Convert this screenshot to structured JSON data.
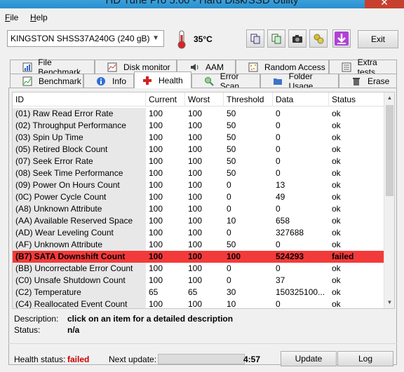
{
  "window": {
    "title": "HD Tune Pro 5.60 - Hard Disk/SSD Utility"
  },
  "menu": [
    {
      "label": "File",
      "accel": "F",
      "rest": "ile"
    },
    {
      "label": "Help",
      "accel": "H",
      "rest": "elp"
    }
  ],
  "toolbar": {
    "drive": "KINGSTON SHSS37A240G (240 gB)",
    "temperature": "35°C",
    "exit_label": "Exit"
  },
  "tabs_top": [
    "File Benchmark",
    "Disk monitor",
    "AAM",
    "Random Access",
    "Extra tests"
  ],
  "tabs_bottom": [
    "Benchmark",
    "Info",
    "Health",
    "Error Scan",
    "Folder Usage",
    "Erase"
  ],
  "active_tab": "Health",
  "table": {
    "columns": [
      "ID",
      "Current",
      "Worst",
      "Threshold",
      "Data",
      "Status"
    ],
    "rows": [
      [
        "(01) Raw Read Error Rate",
        "100",
        "100",
        "50",
        "0",
        "ok"
      ],
      [
        "(02) Throughput Performance",
        "100",
        "100",
        "50",
        "0",
        "ok"
      ],
      [
        "(03) Spin Up Time",
        "100",
        "100",
        "50",
        "0",
        "ok"
      ],
      [
        "(05) Retired Block Count",
        "100",
        "100",
        "50",
        "0",
        "ok"
      ],
      [
        "(07) Seek Error Rate",
        "100",
        "100",
        "50",
        "0",
        "ok"
      ],
      [
        "(08) Seek Time Performance",
        "100",
        "100",
        "50",
        "0",
        "ok"
      ],
      [
        "(09) Power On Hours Count",
        "100",
        "100",
        "0",
        "13",
        "ok"
      ],
      [
        "(0C) Power Cycle Count",
        "100",
        "100",
        "0",
        "49",
        "ok"
      ],
      [
        "(A8) Unknown Attribute",
        "100",
        "100",
        "0",
        "0",
        "ok"
      ],
      [
        "(AA) Available Reserved Space",
        "100",
        "100",
        "10",
        "658",
        "ok"
      ],
      [
        "(AD) Wear Leveling Count",
        "100",
        "100",
        "0",
        "327688",
        "ok"
      ],
      [
        "(AF) Unknown Attribute",
        "100",
        "100",
        "50",
        "0",
        "ok"
      ],
      [
        "(B7) SATA Downshift Count",
        "100",
        "100",
        "100",
        "524293",
        "failed"
      ],
      [
        "(BB) Uncorrectable Error Count",
        "100",
        "100",
        "0",
        "0",
        "ok"
      ],
      [
        "(C0) Unsafe Shutdown Count",
        "100",
        "100",
        "0",
        "37",
        "ok"
      ],
      [
        "(C2) Temperature",
        "65",
        "65",
        "30",
        "150325100...",
        "ok"
      ],
      [
        "(C4) Reallocated Event Count",
        "100",
        "100",
        "10",
        "0",
        "ok"
      ]
    ],
    "highlight_color": "#f33a3a"
  },
  "description": {
    "label": "Description:",
    "value": "click on an item for a detailed description"
  },
  "status": {
    "label": "Status:",
    "value": "n/a"
  },
  "footer": {
    "health_label": "Health status:",
    "health_value": "failed",
    "health_color": "#cc0000",
    "next_label": "Next update:",
    "countdown": "4:57",
    "update_label": "Update",
    "log_label": "Log"
  }
}
